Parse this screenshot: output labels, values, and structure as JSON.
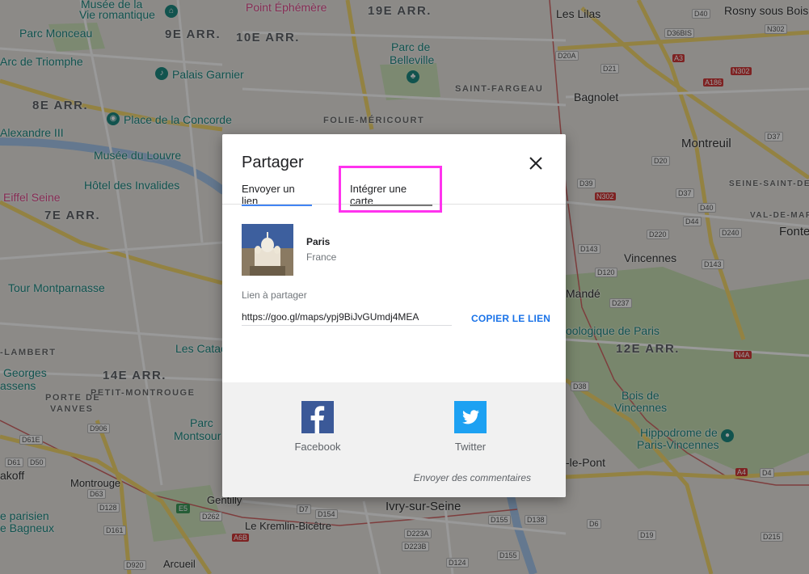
{
  "map": {
    "labels": {
      "musee": "Musée de la",
      "vie_romantique": "Vie romantique",
      "point_ephemere": "Point Éphémère",
      "arr19": "19E ARR.",
      "les_lilas": "Les Lilas",
      "rosny": "Rosny sous Bois",
      "parc_monceau": "Parc Monceau",
      "arr9": "9E ARR.",
      "arr10": "10E ARR.",
      "parc_de": "Parc de",
      "belleville": "Belleville",
      "arc_triomphe": "Arc de Triomphe",
      "palais_garnier": "Palais Garnier",
      "saint_fargeau": "SAINT-FARGEAU",
      "bagnolet": "Bagnolet",
      "arr8": "8E ARR.",
      "place_concorde": "Place de la Concorde",
      "folie_mericourt": "FOLIE-MÉRICOURT",
      "montreuil": "Montreuil",
      "alexandre": "Alexandre III",
      "musee_louvre": "Musée du Louvre",
      "seine_saint_denis": "SEINE-SAINT-DENIS",
      "hotel_invalides": "Hôtel des Invalides",
      "eiffel": "Eiffel Seine",
      "val_de_marne": "VAL-DE-MARNE",
      "arr7": "7E ARR.",
      "fonte": "Fonte",
      "vincennes": "Vincennes",
      "tour_montparnasse": "Tour Montparnasse",
      "mande": "Mandé",
      "zoologique": "oologique de Paris",
      "lambert": "-LAMBERT",
      "les_cata": "Les Catac",
      "arr12": "12E ARR.",
      "georges": "Georges",
      "arr14": "14E ARR.",
      "assens": "assens",
      "petit_montrouge": "PETIT-MONTROUGE",
      "porte_vanves": "PORTE DE",
      "vanves": "VANVES",
      "bois_de": "Bois de",
      "bois_vincennes": "Vincennes",
      "parc": "Parc",
      "montsour": "Montsour",
      "hippodrome": "Hippodrome de",
      "paris_vincennes": "Paris-Vincennes",
      "le_pont": "-le-Pont",
      "akoff": "akoff",
      "montrouge": "Montrouge",
      "gentilly": "Gentilly",
      "ivry": "Ivry-sur-Seine",
      "parisien": "e parisien",
      "bagneux": "e Bagneux",
      "kremlin": "Le Kremlin-Bicêtre",
      "arcueil": "Arcueil"
    },
    "roads": [
      "D40",
      "N302",
      "D36BIS",
      "A3",
      "D20A",
      "D21",
      "A186",
      "N302",
      "D37",
      "D39",
      "D20",
      "N302",
      "D37",
      "D40",
      "D44",
      "D220",
      "D240",
      "D143",
      "D120",
      "D237",
      "D143",
      "N4A",
      "D38",
      "D906",
      "D61E",
      "D50",
      "D61",
      "D63",
      "D128",
      "D161",
      "E5",
      "D262",
      "D7",
      "D154",
      "D155",
      "D138",
      "D6",
      "A6B",
      "D223A",
      "D223B",
      "D19",
      "D124",
      "D155",
      "D920",
      "A4",
      "D4",
      "D215"
    ]
  },
  "dialog": {
    "title": "Partager",
    "tabs": [
      "Envoyer un lien",
      "Intégrer une carte"
    ],
    "place": {
      "name": "Paris",
      "country": "France"
    },
    "link_label": "Lien à partager",
    "link_value": "https://goo.gl/maps/ypj9BiJvGUmdj4MEA",
    "copy_label": "COPIER LE LIEN",
    "share": {
      "facebook": "Facebook",
      "twitter": "Twitter"
    },
    "feedback": "Envoyer des commentaires"
  },
  "colors": {
    "accent": "#1a73e8",
    "active_tab": "#4285f4",
    "facebook": "#3b5998",
    "twitter": "#1da1f2",
    "highlight": "#ff33ee"
  }
}
